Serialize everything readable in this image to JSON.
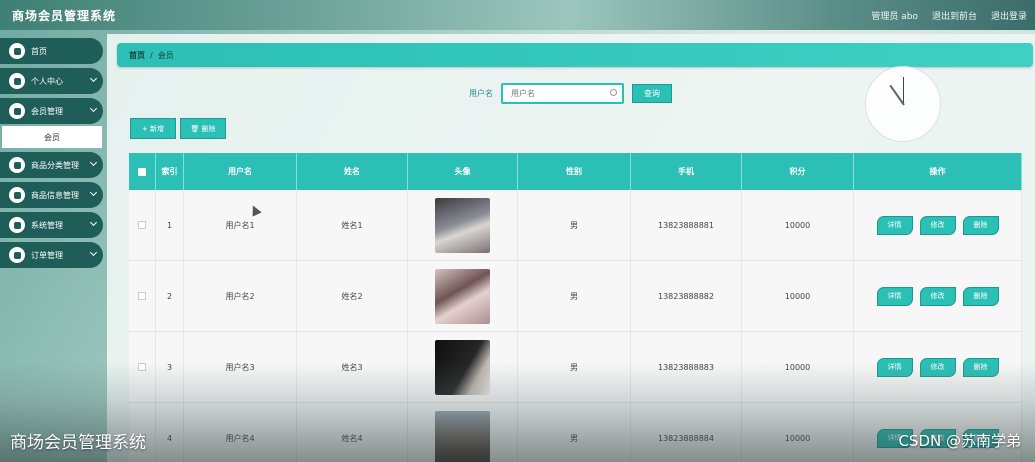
{
  "header": {
    "app_title": "商场会员管理系统",
    "user": "管理员 abo",
    "back_to_front": "退出到前台",
    "logout": "退出登录"
  },
  "sidebar": {
    "items": [
      {
        "label": "首页",
        "icon": "home-icon",
        "has_children": false
      },
      {
        "label": "个人中心",
        "icon": "user-icon",
        "has_children": true
      },
      {
        "label": "会员管理",
        "icon": "member-icon",
        "has_children": true,
        "children": [
          "会员"
        ]
      },
      {
        "label": "商品分类管理",
        "icon": "category-icon",
        "has_children": true
      },
      {
        "label": "商品信息管理",
        "icon": "goods-icon",
        "has_children": true
      },
      {
        "label": "系统管理",
        "icon": "system-icon",
        "has_children": true
      },
      {
        "label": "订单管理",
        "icon": "order-icon",
        "has_children": true
      }
    ]
  },
  "breadcrumb": {
    "home": "首页",
    "separator": "/",
    "current": "会员"
  },
  "search": {
    "label": "用户名",
    "placeholder": "用户名",
    "button": "查询"
  },
  "actions": {
    "add": "+ 新增",
    "delete": "🗑 删除"
  },
  "table": {
    "headers": [
      "",
      "索引",
      "用户名",
      "姓名",
      "头像",
      "性别",
      "手机",
      "积分",
      "操作"
    ],
    "rows": [
      {
        "index": "1",
        "username": "用户名1",
        "name": "姓名1",
        "gender": "男",
        "phone": "13823888881",
        "points": "10000"
      },
      {
        "index": "2",
        "username": "用户名2",
        "name": "姓名2",
        "gender": "男",
        "phone": "13823888882",
        "points": "10000"
      },
      {
        "index": "3",
        "username": "用户名3",
        "name": "姓名3",
        "gender": "男",
        "phone": "13823888883",
        "points": "10000"
      },
      {
        "index": "4",
        "username": "用户名4",
        "name": "姓名4",
        "gender": "男",
        "phone": "13823888884",
        "points": "10000"
      }
    ],
    "row_actions": {
      "detail": "详情",
      "edit": "修改",
      "delete": "删除"
    }
  },
  "watermark": {
    "left": "商场会员管理系统",
    "right": "CSDN @苏南学弟"
  },
  "colors": {
    "accent": "#2bc0b6",
    "sidebar": "#1f5d58"
  }
}
